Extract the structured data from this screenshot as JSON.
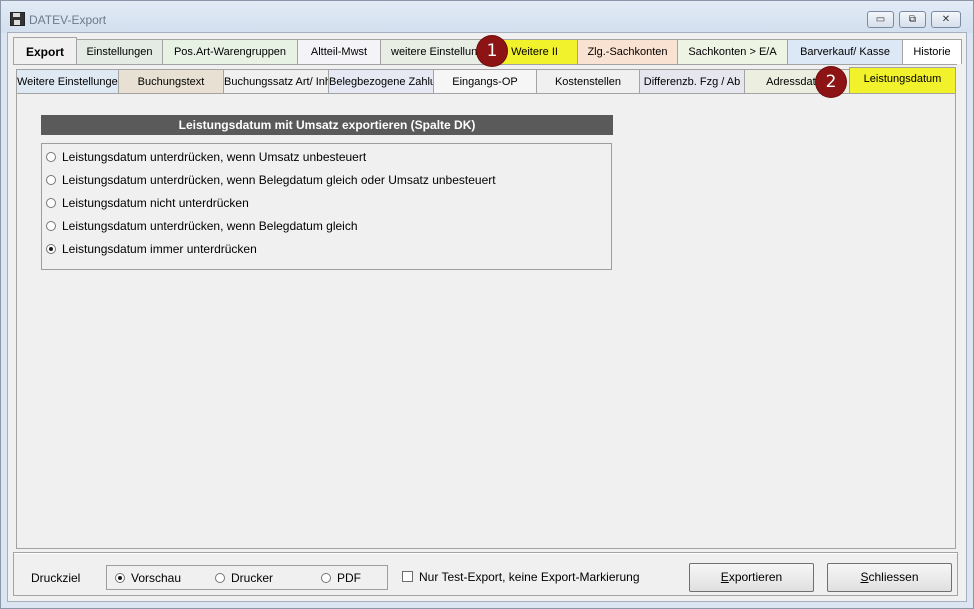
{
  "window": {
    "title": "DATEV-Export"
  },
  "tabs": [
    {
      "label": "Export",
      "color": "#f0f0f0",
      "active": true
    },
    {
      "label": "Einstellungen",
      "color": "#e4ebe4"
    },
    {
      "label": "Pos.Art-Warengruppen",
      "color": "#e8f2e4"
    },
    {
      "label": "Altteil-Mwst",
      "color": "#f4f4f8"
    },
    {
      "label": "weitere Einstellungen",
      "color": "#e8eee4"
    },
    {
      "label": "Weitere II",
      "color": "#f2f22c"
    },
    {
      "label": "Zlg.-Sachkonten",
      "color": "#fae2d2"
    },
    {
      "label": "Sachkonten > E/A",
      "color": "#eef4e4"
    },
    {
      "label": "Barverkauf/ Kasse",
      "color": "#dce8f6"
    },
    {
      "label": "Historie",
      "color": "#ffffff"
    }
  ],
  "subtabs": [
    {
      "label": "Weitere Einstellungen",
      "color": "#dfe9f4"
    },
    {
      "label": "Buchungstext",
      "color": "#e8e0d2"
    },
    {
      "label": "Buchungssatz Art/ Inhalt",
      "color": "#f0f0f0"
    },
    {
      "label": "Belegbezogene Zahlung",
      "color": "#e6e8f4"
    },
    {
      "label": "Eingangs-OP",
      "color": "#f6f6f6"
    },
    {
      "label": "Kostenstellen",
      "color": "#f0f0f0"
    },
    {
      "label": "Differenzb. Fzg / Ab",
      "color": "#e6e6ee"
    },
    {
      "label": "Adressdaten",
      "color": "#eceee0"
    },
    {
      "label": "Leistungsdatum",
      "color": "#f2f22c",
      "active": true
    }
  ],
  "markers": [
    "1",
    "2"
  ],
  "section": {
    "header": "Leistungsdatum mit Umsatz exportieren (Spalte DK)",
    "options": [
      {
        "label": "Leistungsdatum unterdrücken, wenn Umsatz unbesteuert",
        "selected": false
      },
      {
        "label": "Leistungsdatum unterdrücken, wenn Belegdatum gleich oder Umsatz unbesteuert",
        "selected": false
      },
      {
        "label": "Leistungsdatum nicht unterdrücken",
        "selected": false
      },
      {
        "label": "Leistungsdatum unterdrücken, wenn Belegdatum gleich",
        "selected": false
      },
      {
        "label": "Leistungsdatum immer unterdrücken",
        "selected": true
      }
    ]
  },
  "bottom": {
    "druckziel_label": "Druckziel",
    "druckziel_options": [
      {
        "label": "Vorschau",
        "selected": true
      },
      {
        "label": "Drucker",
        "selected": false
      },
      {
        "label": "PDF",
        "selected": false
      }
    ],
    "test_export_label": "Nur Test-Export, keine Export-Markierung",
    "test_export_checked": false,
    "export_button": {
      "access_key": "E",
      "rest": "xportieren"
    },
    "close_button": {
      "access_key": "S",
      "rest": "chliessen"
    }
  }
}
